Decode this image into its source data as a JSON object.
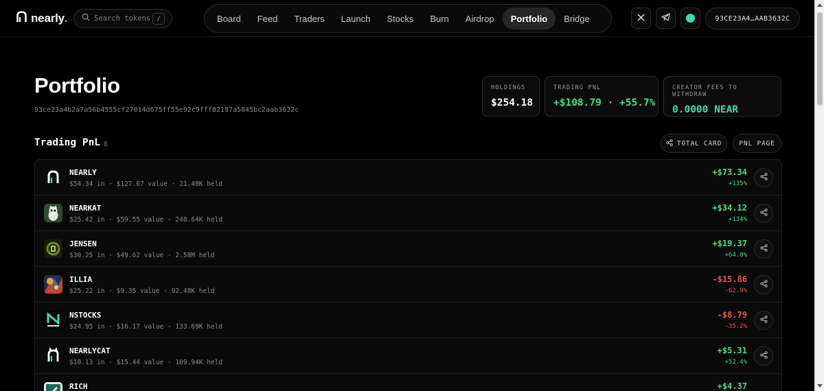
{
  "header": {
    "logo_text": "nearly",
    "logo_dot": ".",
    "search_placeholder": "Search tokens",
    "search_shortcut": "/",
    "nav": [
      {
        "label": "Board",
        "active": false
      },
      {
        "label": "Feed",
        "active": false
      },
      {
        "label": "Traders",
        "active": false
      },
      {
        "label": "Launch",
        "active": false
      },
      {
        "label": "Stocks",
        "active": false
      },
      {
        "label": "Burn",
        "active": false
      },
      {
        "label": "Airdrop",
        "active": false
      },
      {
        "label": "Portfolio",
        "active": true
      },
      {
        "label": "Bridge",
        "active": false
      }
    ],
    "x_icon": "x-logo-icon",
    "telegram_icon": "telegram-icon",
    "status_color": "#3ddbb4",
    "wallet": "93CE23A4…AAB3632C"
  },
  "page": {
    "title": "Portfolio",
    "address": "93ce23a4b2a7a56b4555cf27014d675ff55e92c9fff82187a5045bc2aab3632c"
  },
  "stats": {
    "holdings": {
      "label": "HOLDINGS",
      "value": "$254.18"
    },
    "trading_pnl": {
      "label": "TRADING PNL",
      "value": "+$108.79 · +55.7%"
    },
    "creator_fees": {
      "label": "CREATOR FEES TO WITHDRAW",
      "value": "0.0000 NEAR"
    }
  },
  "section": {
    "title": "Trading PnL",
    "count": "8",
    "total_card_label": "TOTAL CARD",
    "pnl_page_label": "PNL PAGE"
  },
  "colors": {
    "accent": "#3ddbb4",
    "positive": "#4ade80",
    "negative": "#f0564e"
  },
  "rows": [
    {
      "name": "NEARLY",
      "sub": "$54.34 in · $127.67 value · 21.40K held",
      "pnl": "+$73.34",
      "pct": "+135%",
      "positive": true,
      "icon": "nearly-logo-icon"
    },
    {
      "name": "NEARKAT",
      "sub": "$25.42 in · $59.55 value · 248.64K held",
      "pnl": "+$34.12",
      "pct": "+134%",
      "positive": true,
      "icon": "nearkat-token-icon"
    },
    {
      "name": "JENSEN",
      "sub": "$30.25 in · $49.62 value · 2.58M held",
      "pnl": "+$19.37",
      "pct": "+64.0%",
      "positive": true,
      "icon": "jensen-token-icon"
    },
    {
      "name": "ILLIA",
      "sub": "$25.22 in · $9.35 value · 92.48K held",
      "pnl": "-$15.86",
      "pct": "-62.9%",
      "positive": false,
      "icon": "illia-token-icon"
    },
    {
      "name": "NSTOCKS",
      "sub": "$24.95 in · $16.17 value · 133.69K held",
      "pnl": "-$8.79",
      "pct": "-35.2%",
      "positive": false,
      "icon": "nstocks-token-icon"
    },
    {
      "name": "NEARLYCAT",
      "sub": "$10.13 in · $15.44 value · 109.94K held",
      "pnl": "+$5.31",
      "pct": "+52.4%",
      "positive": true,
      "icon": "nearlycat-token-icon"
    },
    {
      "name": "RICH",
      "sub": "",
      "pnl": "+$4.37",
      "pct": "",
      "positive": true,
      "icon": "rich-token-icon"
    }
  ]
}
